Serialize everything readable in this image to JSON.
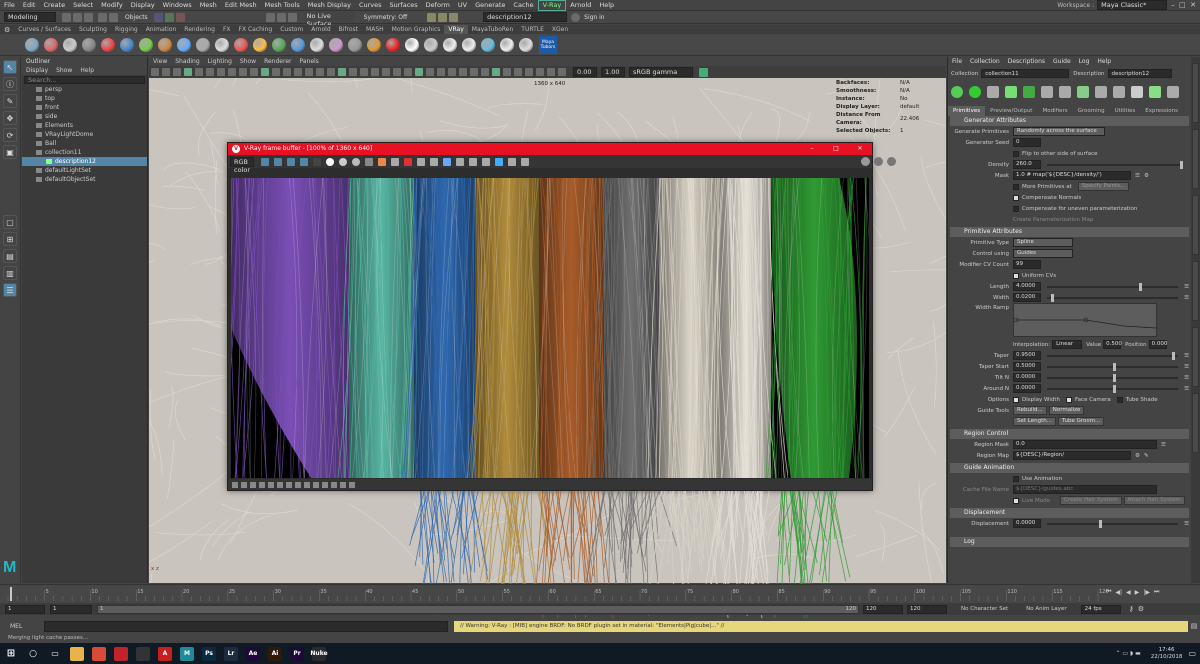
{
  "menubar": {
    "items": [
      "File",
      "Edit",
      "Create",
      "Select",
      "Modify",
      "Display",
      "Windows",
      "Mesh",
      "Edit Mesh",
      "Mesh Tools",
      "Mesh Display",
      "Curves",
      "Surfaces",
      "Deform",
      "UV",
      "Generate",
      "Cache",
      "V-Ray",
      "Arnold",
      "Help"
    ],
    "highlight_index": 17,
    "workspace_label": "Workspace :",
    "workspace_value": "Maya Classic*"
  },
  "statusline": {
    "mode": "Modeling",
    "objects": "Objects",
    "live_surface": "No Live Surface",
    "symmetry": "Symmetry: Off",
    "search": "description12",
    "signin": "Sign in"
  },
  "shelftabs": [
    "Curves / Surfaces",
    "Sculpting",
    "Rigging",
    "Animation",
    "Rendering",
    "FX",
    "FX Caching",
    "Custom",
    "Arnold",
    "Bifrost",
    "MASH",
    "Motion Graphics",
    "VRay",
    "MayaTuboRen",
    "TURTLE",
    "XGen"
  ],
  "shelftab_active": 12,
  "shelf_logo": "Maya Tubors",
  "outliner": {
    "title": "Outliner",
    "menu": [
      "Display",
      "Show",
      "Help"
    ],
    "search": "Search...",
    "items": [
      {
        "label": "persp",
        "indent": 1,
        "sel": false
      },
      {
        "label": "top",
        "indent": 1,
        "sel": false
      },
      {
        "label": "front",
        "indent": 1,
        "sel": false
      },
      {
        "label": "side",
        "indent": 1,
        "sel": false
      },
      {
        "label": "Elements",
        "indent": 1,
        "sel": false
      },
      {
        "label": "VRayLightDome",
        "indent": 1,
        "sel": false
      },
      {
        "label": "Ball",
        "indent": 1,
        "sel": false
      },
      {
        "label": "collection11",
        "indent": 1,
        "sel": false
      },
      {
        "label": "description12",
        "indent": 2,
        "sel": true
      },
      {
        "label": "defaultLightSet",
        "indent": 1,
        "sel": false
      },
      {
        "label": "defaultObjectSet",
        "indent": 1,
        "sel": false
      }
    ]
  },
  "viewport": {
    "menu": [
      "View",
      "Shading",
      "Lighting",
      "Show",
      "Renderer",
      "Panels"
    ],
    "resolution": "1360 x 640",
    "gamma": "sRGB gamma",
    "val1": "0.00",
    "val2": "1.00",
    "hud": [
      [
        "Backfaces:",
        "N/A"
      ],
      [
        "Smoothness:",
        "N/A"
      ],
      [
        "Instance:",
        "No"
      ],
      [
        "Display Layer:",
        "default"
      ],
      [
        "Distance From Camera:",
        "22.406"
      ],
      [
        "Selected Objects:",
        "1"
      ]
    ],
    "axis": "x z"
  },
  "vfb": {
    "title": "V-Ray frame buffer - [100% of 1360 x 640]",
    "channel": "RGB color",
    "hair_colors": [
      "#7a4fb6",
      "#57b5a2",
      "#2f68ae",
      "#b08c3c",
      "#a75c2a",
      "#6f6f6f",
      "#d9d4c5",
      "#e6e1d6",
      "#2f9a33"
    ]
  },
  "attr": {
    "menu": [
      "File",
      "Collection",
      "Descriptions",
      "Guide",
      "Log",
      "Help"
    ],
    "collection_label": "Collection",
    "collection_value": "collection11",
    "description_label": "Description",
    "description_value": "description12",
    "tabs": [
      "Primitives",
      "Preview/Output",
      "Modifiers",
      "Grooming",
      "Utilities",
      "Expressions"
    ],
    "generator_header": "Generator Attributes",
    "gen_primitives_label": "Generate Primitives",
    "gen_primitives_value": "Randomly across the surface",
    "generator_seed_label": "Generator Seed",
    "generator_seed_value": "0",
    "flip_label": "Flip to other side of surface",
    "density_label": "Density",
    "density_value": "260.0",
    "mask_label": "Mask",
    "mask_value": "1.0 # map('${DESC}/density/')",
    "more_primitives": "More Primitives at",
    "specify_points": "Specify Points...",
    "compensate_normals": "Compensate Normals",
    "compensate_uneven": "Compensate for uneven parameterization",
    "create_param_map": "Create Parameterization Map",
    "primitive_header": "Primitive Attributes",
    "primitive_type_label": "Primitive Type",
    "primitive_type_value": "Spline",
    "control_using_label": "Control using",
    "control_using_value": "Guides",
    "modifier_cv_label": "Modifier CV Count",
    "modifier_cv_value": "99",
    "uniform_cvs": "Uniform CVs",
    "length_label": "Length",
    "length_value": "4.0000",
    "width_label": "Width",
    "width_value": "0.0200",
    "width_ramp_label": "Width Ramp",
    "interp_label": "Interpolation:",
    "interp_value": "Linear",
    "value_label": "Value",
    "value_value": "0.500",
    "position_label": "Position",
    "position_value": "0.000",
    "taper_label": "Taper",
    "taper_value": "0.9500",
    "taper_start_label": "Taper Start",
    "taper_start_value": "0.5000",
    "tilt_n_label": "Tilt N",
    "tilt_n_value": "0.0000",
    "around_n_label": "Around N",
    "around_n_value": "0.0000",
    "options_label": "Options",
    "display_width": "Display Width",
    "face_camera": "Face Camera",
    "tube_shade": "Tube Shade",
    "guide_tools_label": "Guide Tools",
    "rebuild": "Rebuild...",
    "normalize": "Normalize",
    "set_length": "Set Length...",
    "tube_groom": "Tube Groom...",
    "region_header": "Region Control",
    "region_mask_label": "Region Mask",
    "region_mask_value": "0.0",
    "region_map_label": "Region Map",
    "region_map_value": "${DESC}/Region/",
    "guide_anim_header": "Guide Animation",
    "use_animation": "Use Animation",
    "cache_file_label": "Cache File Name",
    "cache_file_value": "${DESC}/guides.abc",
    "live_mode": "Live Mode",
    "create_hair_system": "Create Hair System",
    "attach_hair_system": "Attach Hair System",
    "displacement_header": "Displacement",
    "displacement_label": "Displacement",
    "displacement_value": "0.0000",
    "log_header": "Log"
  },
  "timeline": {
    "ticks": [
      "5",
      "10",
      "15",
      "20",
      "25",
      "30",
      "35",
      "40",
      "45",
      "50",
      "55",
      "60",
      "65",
      "70",
      "75",
      "80",
      "85",
      "90",
      "95",
      "100",
      "105",
      "110",
      "115",
      "120"
    ],
    "current_frame": "1",
    "range_start": "1",
    "range_inner_start": "1",
    "range_inner_end": "120",
    "range_end": "120",
    "range_end2": "120",
    "range_max": "120",
    "character_set": "No Character Set",
    "anim_layer": "No Anim Layer",
    "fps": "24 fps"
  },
  "cmdline": {
    "mel": "MEL",
    "warning": "// Warning: V-Ray : [MIB] engine BRDF: No BRDF plugin set in material: \"Elements|Pig|cube|...\" //"
  },
  "helpline": "Merging light cache passes...",
  "taskbar": {
    "time": "17:46",
    "date": "22/10/2018",
    "icons": [
      {
        "name": "windows-start-icon",
        "label": "",
        "color": "#101a24"
      },
      {
        "name": "search-icon",
        "label": "",
        "color": "#101a24"
      },
      {
        "name": "task-view-icon",
        "label": "",
        "color": "#101a24"
      },
      {
        "name": "explorer-icon",
        "label": "",
        "color": "#e8b44a"
      },
      {
        "name": "chrome-icon",
        "label": "",
        "color": "#d94a38"
      },
      {
        "name": "media-icon",
        "label": "",
        "color": "#c2222a"
      },
      {
        "name": "app-icon",
        "label": "",
        "color": "#333"
      },
      {
        "name": "acrobat-icon",
        "label": "A",
        "color": "#c81e1e"
      },
      {
        "name": "maya-icon",
        "label": "M",
        "color": "#1f8a9a"
      },
      {
        "name": "photoshop-icon",
        "label": "Ps",
        "color": "#0c2940"
      },
      {
        "name": "lightroom-icon",
        "label": "Lr",
        "color": "#1a2c3e"
      },
      {
        "name": "after-effects-icon",
        "label": "Ae",
        "color": "#1d0a38"
      },
      {
        "name": "illustrator-icon",
        "label": "Ai",
        "color": "#2e1a05"
      },
      {
        "name": "premiere-icon",
        "label": "Pr",
        "color": "#1d0a38"
      },
      {
        "name": "nuke-icon",
        "label": "Nuke",
        "color": "#2a2a2a"
      }
    ]
  }
}
